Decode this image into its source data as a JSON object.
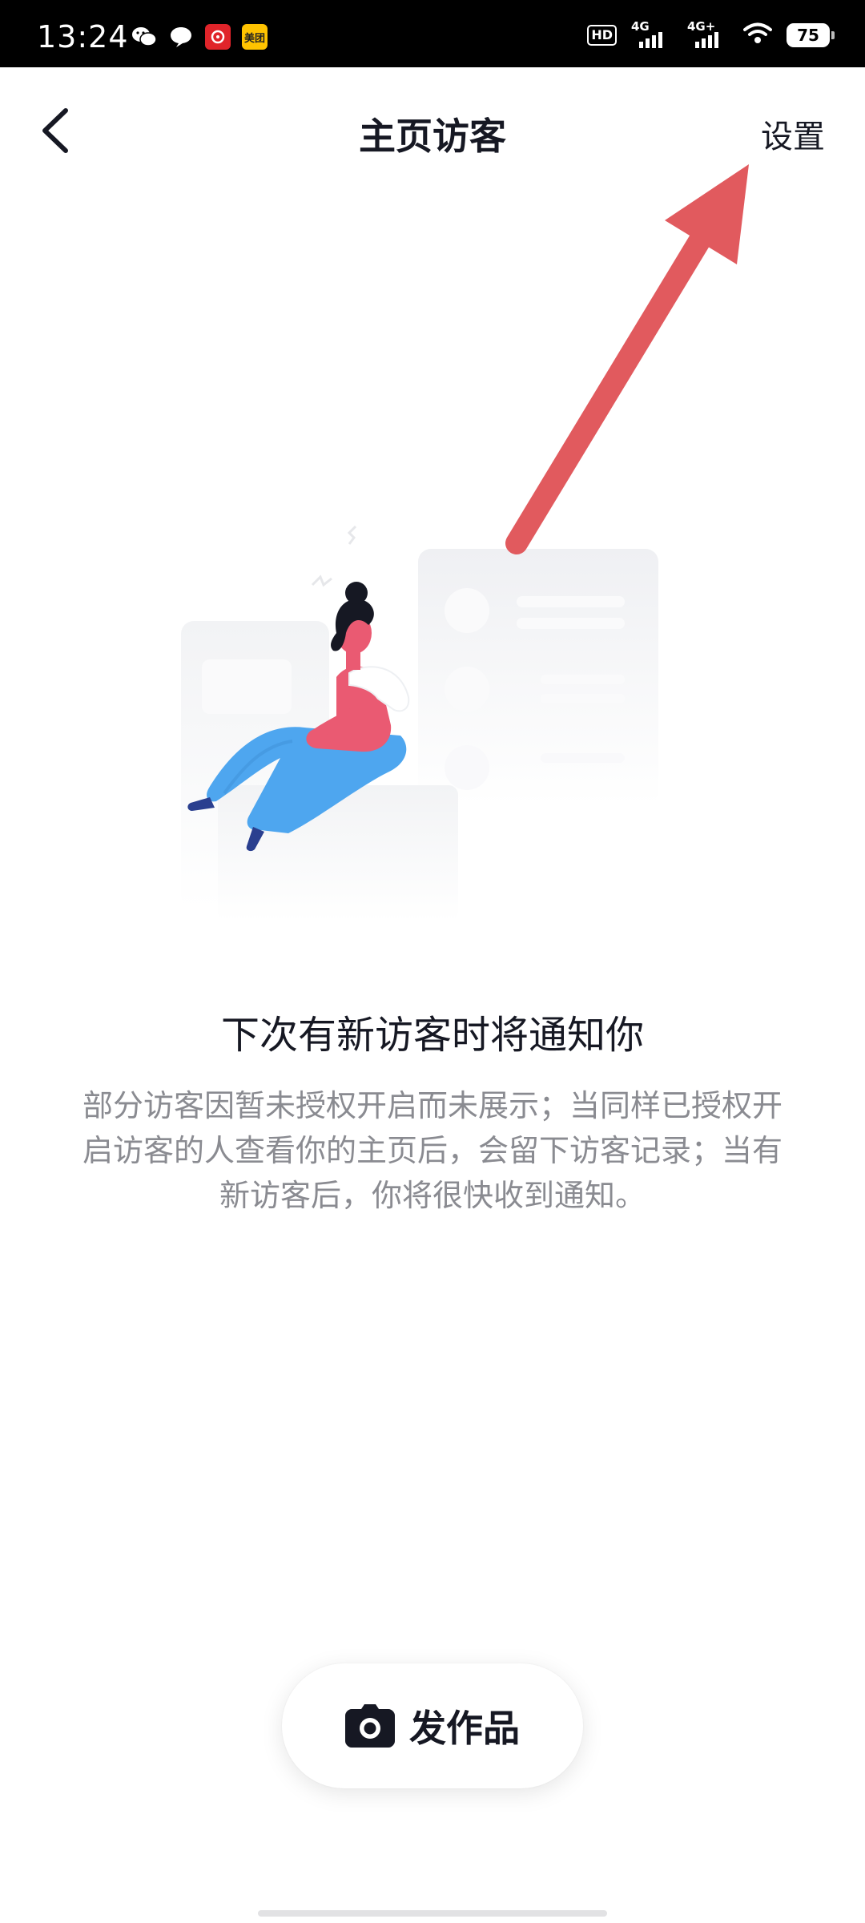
{
  "status_bar": {
    "time": "13:24",
    "hd": "HD",
    "net1": "4G",
    "net2": "4G+",
    "battery": "75",
    "meituan_label": "美团"
  },
  "header": {
    "title": "主页访客",
    "settings_label": "设置"
  },
  "empty_state": {
    "title": "下次有新访客时将通知你",
    "description": "部分访客因暂未授权开启而未展示；当同样已授权开启访客的人查看你的主页后，会留下访客记录；当有新访客后，你将很快收到通知。"
  },
  "publish_button": {
    "label": "发作品"
  },
  "colors": {
    "arrow": "#e15a5e",
    "figure_shirt": "#ea5a72",
    "figure_pants": "#4ea6ef",
    "text_primary": "#161823",
    "text_secondary": "#8a8b91"
  }
}
